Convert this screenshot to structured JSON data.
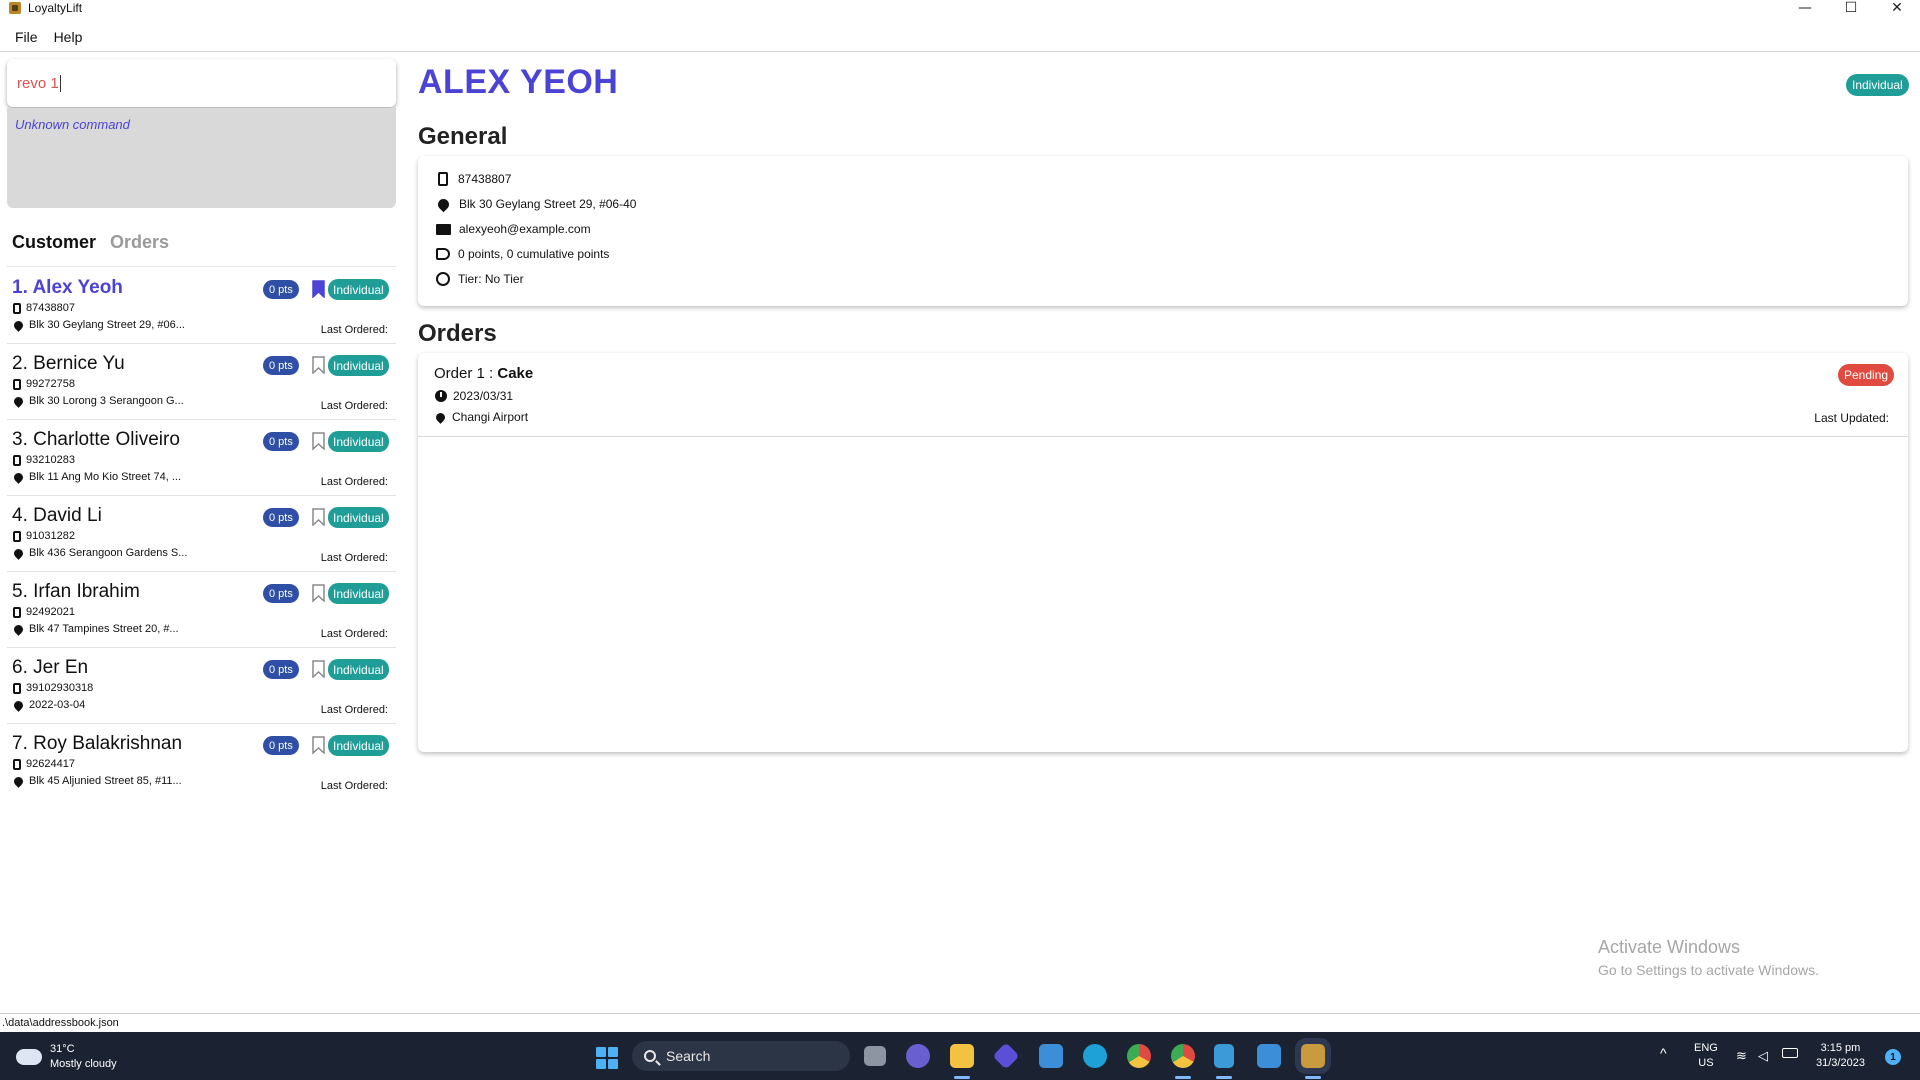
{
  "window": {
    "title": "LoyaltyLift",
    "minimize": "—",
    "maximize": "☐",
    "close": "✕"
  },
  "menu": {
    "file": "File",
    "help": "Help"
  },
  "command": {
    "value": "revo 1",
    "result": "Unknown command"
  },
  "tabs": {
    "customer": "Customer",
    "orders": "Orders"
  },
  "customers": [
    {
      "index": "1.",
      "name": "Alex Yeoh",
      "phone": "87438807",
      "address": "Blk 30 Geylang Street 29, #06...",
      "points": "0 pts",
      "type": "Individual",
      "last_ordered": "Last Ordered:",
      "bookmarked": true
    },
    {
      "index": "2.",
      "name": "Bernice Yu",
      "phone": "99272758",
      "address": "Blk 30 Lorong 3 Serangoon G...",
      "points": "0 pts",
      "type": "Individual",
      "last_ordered": "Last Ordered:",
      "bookmarked": false
    },
    {
      "index": "3.",
      "name": "Charlotte Oliveiro",
      "phone": "93210283",
      "address": "Blk 11 Ang Mo Kio Street 74, ...",
      "points": "0 pts",
      "type": "Individual",
      "last_ordered": "Last Ordered:",
      "bookmarked": false
    },
    {
      "index": "4.",
      "name": "David Li",
      "phone": "91031282",
      "address": "Blk 436 Serangoon Gardens S...",
      "points": "0 pts",
      "type": "Individual",
      "last_ordered": "Last Ordered:",
      "bookmarked": false
    },
    {
      "index": "5.",
      "name": "Irfan Ibrahim",
      "phone": "92492021",
      "address": "Blk 47 Tampines Street 20, #...",
      "points": "0 pts",
      "type": "Individual",
      "last_ordered": "Last Ordered:",
      "bookmarked": false
    },
    {
      "index": "6.",
      "name": "Jer En",
      "phone": "39102930318",
      "address": "2022-03-04",
      "points": "0 pts",
      "type": "Individual",
      "last_ordered": "Last Ordered:",
      "bookmarked": false
    },
    {
      "index": "7.",
      "name": "Roy Balakrishnan",
      "phone": "92624417",
      "address": "Blk 45 Aljunied Street 85, #11...",
      "points": "0 pts",
      "type": "Individual",
      "last_ordered": "Last Ordered:",
      "bookmarked": false
    }
  ],
  "detail": {
    "name": "ALEX YEOH",
    "type": "Individual",
    "general_title": "General",
    "phone": "87438807",
    "address": "Blk 30 Geylang Street 29, #06-40",
    "email": "alexyeoh@example.com",
    "points": "0 points, 0 cumulative points",
    "tier": "Tier: No Tier",
    "orders_title": "Orders",
    "order": {
      "prefix": "Order 1 : ",
      "item": "Cake",
      "date": "2023/03/31",
      "location": "Changi Airport",
      "status": "Pending",
      "last_updated": "Last Updated:"
    }
  },
  "activate": {
    "line1": "Activate Windows",
    "line2": "Go to Settings to activate Windows."
  },
  "statusbar": {
    "path": ".\\data\\addressbook.json"
  },
  "taskbar": {
    "temp": "31°C",
    "weather": "Mostly cloudy",
    "search": "Search",
    "lang1": "ENG",
    "lang2": "US",
    "time": "3:15 pm",
    "date": "31/3/2023",
    "notifications": "1"
  },
  "colors": {
    "accent": "#4b43d6",
    "teal": "#1f9e98",
    "pts_blue": "#2f4fa6",
    "pending_red": "#e04a3f",
    "taskbar": "#1b2332"
  }
}
